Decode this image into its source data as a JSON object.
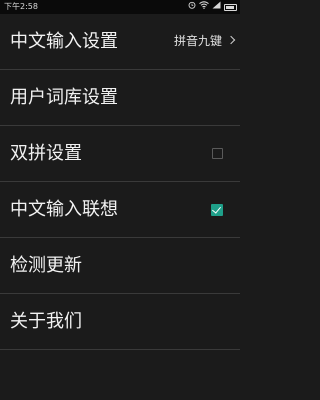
{
  "status_bar": {
    "time": "下午2:58",
    "icons": [
      "alarm-icon",
      "wifi-icon",
      "signal-icon",
      "battery-icon"
    ],
    "bg_color": "#0a0a0a",
    "text_color": "#d8d8d8"
  },
  "theme": {
    "background": "#1b1b1b",
    "divider": "#3a3a3a",
    "text": "#f2f2f2",
    "accent": "#1fa08a"
  },
  "settings": {
    "items": [
      {
        "label": "中文输入设置",
        "value": "拼音九键",
        "control": "chevron-right-icon"
      },
      {
        "label": "用户词库设置"
      },
      {
        "label": "双拼设置",
        "control": "checkbox",
        "checked": false
      },
      {
        "label": "中文输入联想",
        "control": "checkbox",
        "checked": true
      },
      {
        "label": "检测更新"
      },
      {
        "label": "关于我们"
      }
    ]
  }
}
